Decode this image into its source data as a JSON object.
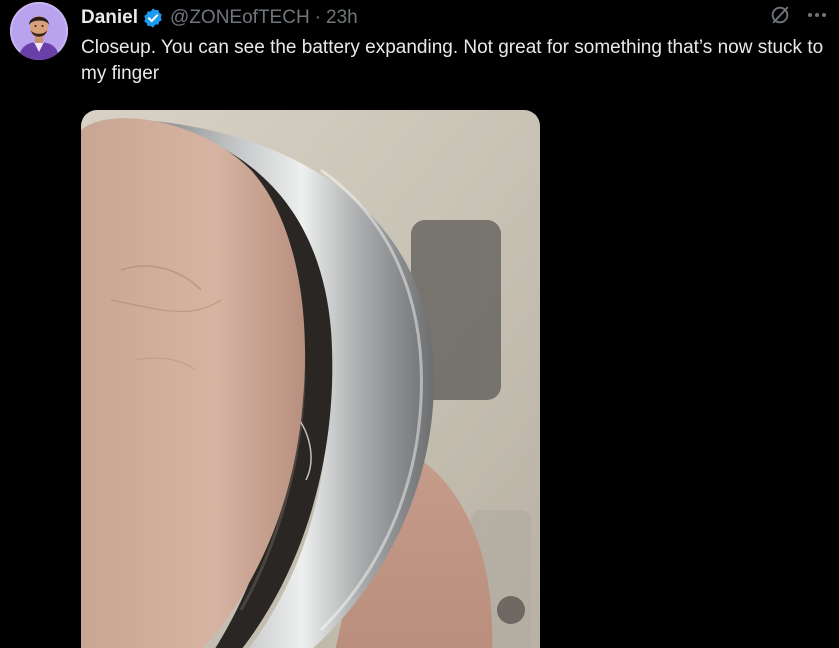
{
  "tweet": {
    "display_name": "Daniel",
    "handle": "@ZONEofTECH",
    "separator": "·",
    "time": "23h",
    "text": "Closeup. You can see the battery expanding. Not great for something that’s now stuck to my finger"
  },
  "icons": {
    "avatar": "avatar",
    "verified": "verified-badge-icon",
    "grok": "grok-icon",
    "more": "more-icon"
  },
  "colors": {
    "background": "#000000",
    "text": "#e7e9ea",
    "secondary": "#71767b",
    "verified": "#1d9bf0",
    "avatar_bg": "#c9b6f2"
  }
}
